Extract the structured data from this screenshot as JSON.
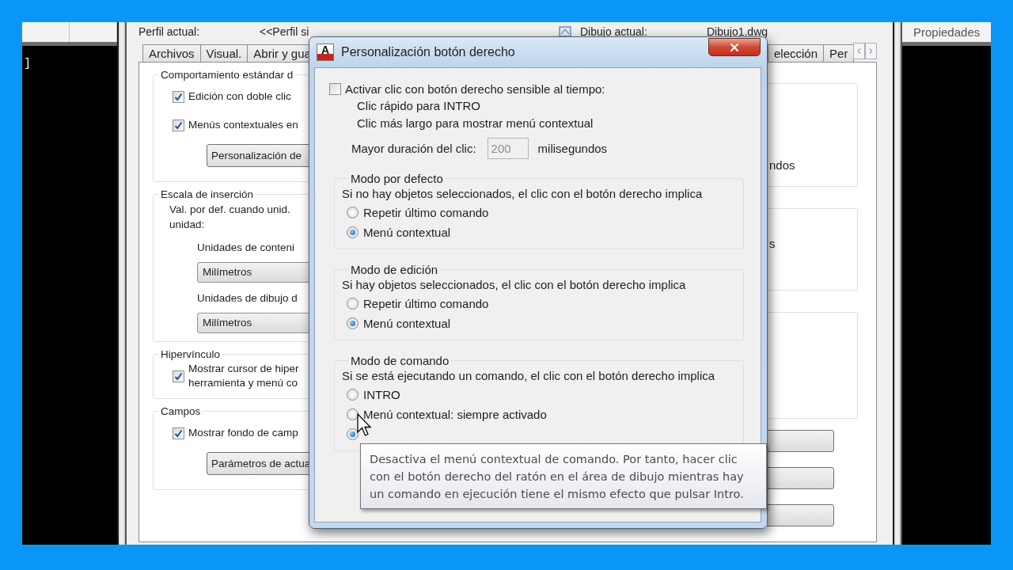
{
  "drawing_area_left": {
    "text": "]"
  },
  "options_window": {
    "profile_label": "Perfil actual:",
    "profile_value": "<<Perfil si",
    "drawing_label": "Dibujo actual:",
    "drawing_value": "Dibujo1.dwg",
    "tabs_left": [
      {
        "label": "Archivos",
        "selected": false
      },
      {
        "label": "Visual.",
        "selected": false
      },
      {
        "label": "Abrir y gua",
        "selected": false
      }
    ],
    "tabs_right": [
      {
        "label": "elección",
        "selected": false
      },
      {
        "label": "Per",
        "selected": false
      }
    ],
    "groups": [
      {
        "legend": "Comportamiento estándar d",
        "items": [
          {
            "kind": "checkbox",
            "label": "Edición con doble clic",
            "checked": true
          },
          {
            "kind": "checkbox",
            "label": "Menús contextuales en",
            "checked": true
          },
          {
            "kind": "button",
            "label": "Personalización de"
          }
        ]
      },
      {
        "legend": "Escala de inserción",
        "items": [
          {
            "kind": "text",
            "lines": [
              "Val. por def. cuando unid.",
              "unidad:"
            ]
          },
          {
            "kind": "label",
            "label": "Unidades de conteni"
          },
          {
            "kind": "select",
            "value": "Milímetros"
          },
          {
            "kind": "label",
            "label": "Unidades de dibujo d"
          },
          {
            "kind": "select",
            "value": "Milímetros"
          }
        ]
      },
      {
        "legend": "Hipervínculo",
        "items": [
          {
            "kind": "checkbox",
            "lines": [
              "Mostrar cursor de hiper",
              "herramienta y menú co"
            ],
            "checked": true
          }
        ]
      },
      {
        "legend": "Campos",
        "items": [
          {
            "kind": "checkbox",
            "label": "Mostrar fondo de camp",
            "checked": true
          },
          {
            "kind": "button",
            "label": "Parámetros de actua"
          }
        ]
      }
    ],
    "right_group_texts": [
      "ndos",
      "s"
    ]
  },
  "properties_panel": {
    "title": "Propiedades"
  },
  "dialog": {
    "icon_letter": "A",
    "title": "Personalización botón derecho",
    "time_sensitive": {
      "label": "Activar clic con botón derecho sensible al tiempo:",
      "checked": false,
      "notes": [
        "Clic rápido para INTRO",
        "Clic más largo para mostrar menú contextual"
      ],
      "duration_label": "Mayor duración del clic:",
      "duration_value": "200",
      "duration_disabled": true,
      "duration_unit": "milisegundos"
    },
    "groups": [
      {
        "legend": "Modo por defecto",
        "description": "Si no hay objetos seleccionados, el clic con el botón derecho implica",
        "options": [
          {
            "label": "Repetir último comando",
            "selected": false
          },
          {
            "label": "Menú contextual",
            "selected": true
          }
        ]
      },
      {
        "legend": "Modo de edición",
        "description": "Si hay objetos seleccionados, el clic con el botón derecho implica",
        "options": [
          {
            "label": "Repetir último comando",
            "selected": false
          },
          {
            "label": "Menú contextual",
            "selected": true
          }
        ]
      },
      {
        "legend": "Modo de comando",
        "description": "Si se está ejecutando un comando, el clic con el botón derecho implica",
        "options": [
          {
            "label": "INTRO",
            "selected": false
          },
          {
            "label": "Menú contextual: siempre activado",
            "selected": false
          },
          {
            "selected": true
          }
        ]
      }
    ],
    "tooltip": "Desactiva el menú contextual de comando. Por tanto, hacer clic con el botón derecho del ratón en el área de dibujo mientras hay un comando en ejecución tiene el mismo efecto que pulsar Intro."
  }
}
